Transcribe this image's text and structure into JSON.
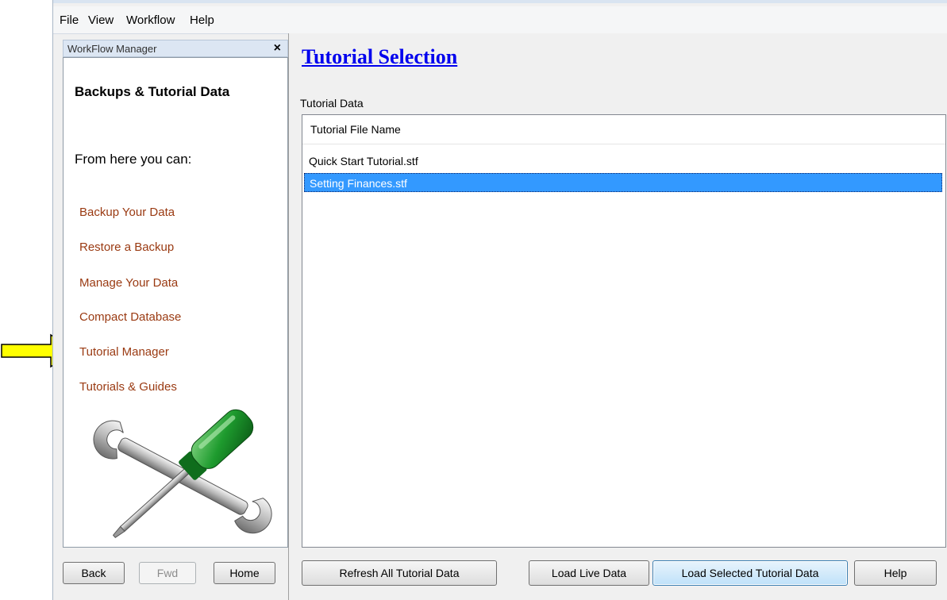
{
  "menu": [
    "File",
    "View",
    "Workflow",
    "Help"
  ],
  "workflow_panel": {
    "header_title": "WorkFlow Manager",
    "close_glyph": "×",
    "title": "Backups & Tutorial Data",
    "intro": "From here you can:",
    "links": [
      "Backup Your Data",
      "Restore a Backup",
      "Manage Your Data",
      "Compact Database",
      "Tutorial Manager",
      "Tutorials & Guides"
    ],
    "nav": {
      "back": "Back",
      "fwd": "Fwd",
      "home": "Home"
    }
  },
  "main": {
    "title": "Tutorial Selection",
    "group_label": "Tutorial Data",
    "column_header": "Tutorial File Name",
    "rows": [
      "Quick Start Tutorial.stf",
      "Setting Finances.stf"
    ],
    "selected_row": 1,
    "buttons": {
      "refresh": "Refresh All Tutorial Data",
      "load_live": "Load Live Data",
      "load_selected": "Load Selected Tutorial Data",
      "help": "Help"
    }
  },
  "colors": {
    "link": "#9a3a12",
    "selection": "#3399ff",
    "title_link": "#0000ee",
    "arrow": "#ffff00"
  },
  "icons": [
    "close-icon",
    "screwdriver-wrench-icon",
    "pointer-arrow-icon"
  ]
}
